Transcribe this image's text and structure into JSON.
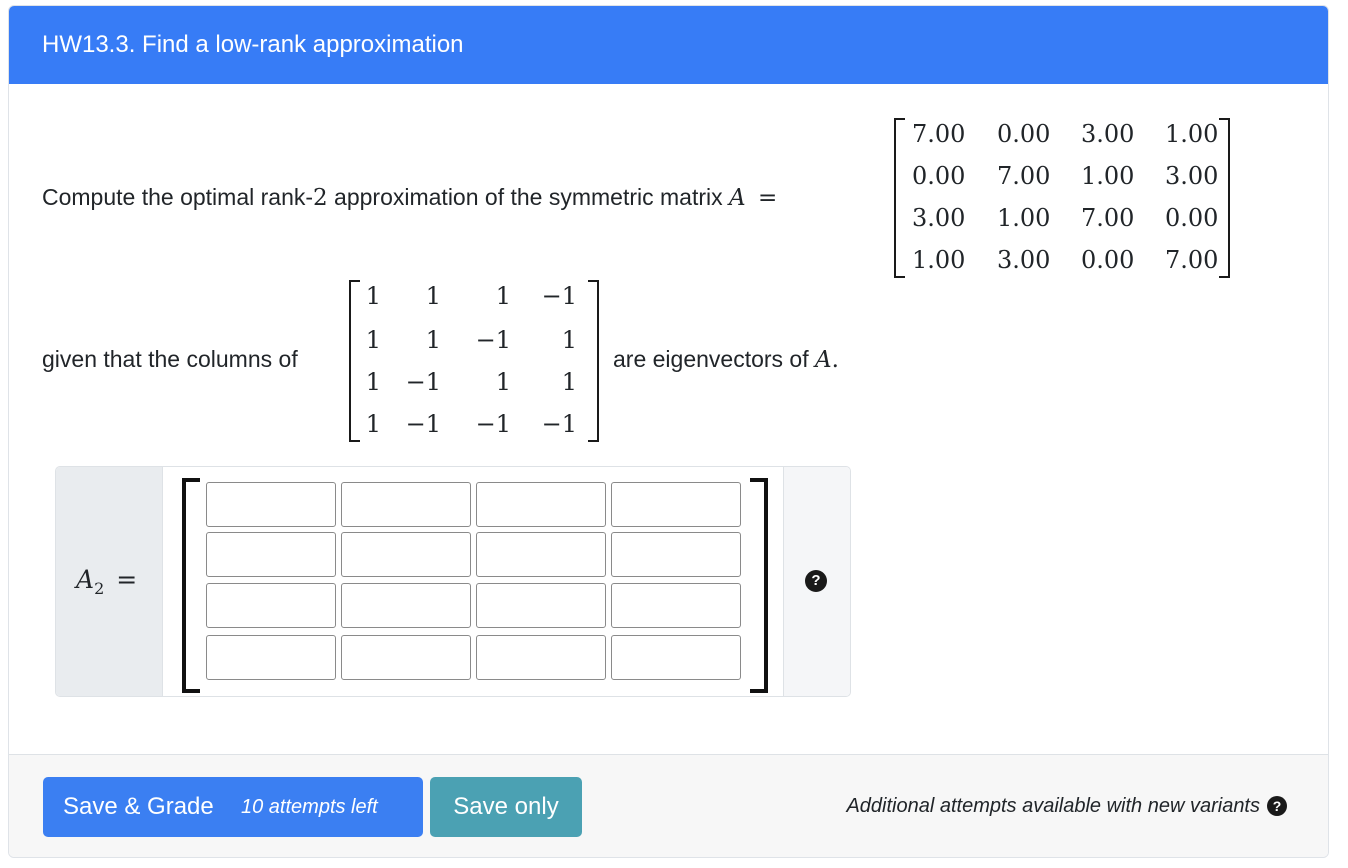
{
  "header": {
    "title": "HW13.3. Find a low-rank approximation"
  },
  "question": {
    "line1_text": "Compute the optimal rank-",
    "rank": "2",
    "line1_text_after": " approximation of the symmetric matrix ",
    "matrix_symbol": "A",
    "equals": "=",
    "matrix_A": [
      [
        "7.00",
        "0.00",
        "3.00",
        "1.00"
      ],
      [
        "0.00",
        "7.00",
        "1.00",
        "3.00"
      ],
      [
        "3.00",
        "1.00",
        "7.00",
        "0.00"
      ],
      [
        "1.00",
        "3.00",
        "0.00",
        "7.00"
      ]
    ],
    "line2_text": "given that the columns of",
    "eigen_matrix": [
      [
        "1",
        "1",
        "1",
        "−1"
      ],
      [
        "1",
        "1",
        "−1",
        "1"
      ],
      [
        "1",
        "−1",
        "1",
        "1"
      ],
      [
        "1",
        "−1",
        "−1",
        "−1"
      ]
    ],
    "line2_text_after": "are eigenvectors of ",
    "line2_symbol": "A",
    "line2_period": "."
  },
  "answer": {
    "label_symbol": "A",
    "label_subscript": "2",
    "label_equals": "=",
    "help_icon": "?",
    "cells": [
      [
        "",
        "",
        "",
        ""
      ],
      [
        "",
        "",
        "",
        ""
      ],
      [
        "",
        "",
        "",
        ""
      ],
      [
        "",
        "",
        "",
        ""
      ]
    ]
  },
  "footer": {
    "grade_label": "Save & Grade",
    "attempts_label": "10 attempts left",
    "save_label": "Save only",
    "note": "Additional attempts available with new variants",
    "help_icon": "?"
  },
  "colors": {
    "header_bg": "#377cf6",
    "grade_button": "#3b7ff2",
    "save_button": "#4ba1b3"
  }
}
